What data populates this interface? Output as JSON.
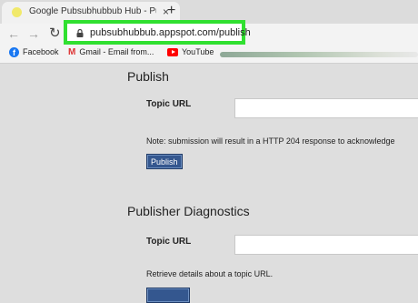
{
  "browser": {
    "tab_title": "Google Pubsubhubbub Hub - Pu",
    "tab_close": "×",
    "new_tab": "+",
    "url": "pubsubhubbub.appspot.com/publish",
    "highlight_color": "#30e030"
  },
  "bookmarks": [
    {
      "label": "Facebook",
      "icon": "facebook-icon"
    },
    {
      "label": "Gmail - Email from...",
      "icon": "gmail-icon"
    },
    {
      "label": "YouTube",
      "icon": "youtube-icon"
    }
  ],
  "publish": {
    "title": "Publish",
    "topic_label": "Topic URL",
    "note": "Note: submission will result in a HTTP 204 response to acknowledge",
    "button": "Publish"
  },
  "diagnostics": {
    "title": "Publisher Diagnostics",
    "topic_label": "Topic URL",
    "note": "Retrieve details about a topic URL."
  }
}
